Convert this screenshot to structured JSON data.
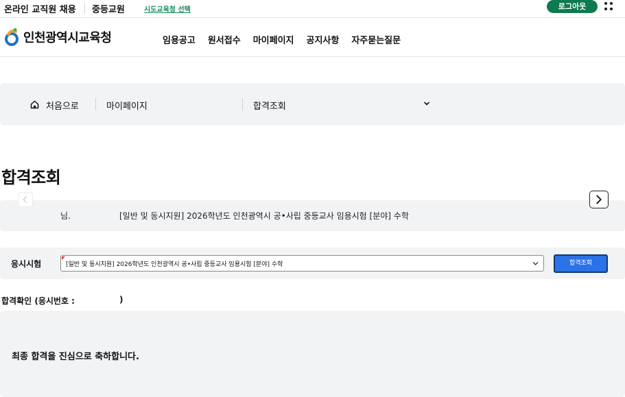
{
  "topbar": {
    "site_name": "온라인 교직원 채용",
    "site_sub": "중등교원",
    "region_link": "시도교육청 선택",
    "logout_label": "로그아웃"
  },
  "navbar": {
    "logo_text": "인천광역시교육청",
    "menu": [
      "임용공고",
      "원서접수",
      "마이페이지",
      "공지사항",
      "자주묻는질문"
    ]
  },
  "breadcrumb": {
    "home": "처음으로",
    "level1": "마이페이지",
    "current": "합격조회"
  },
  "page_title": "합격조회",
  "notice": {
    "name_suffix": "님.",
    "exam_name": "[일반 및 동시지원] 2026학년도 인천광역시 공•사립 중등교사 임용시험 [분야] 수학"
  },
  "exam": {
    "label": "응시시험",
    "selected": "[일반 및 동시지원] 2026학년도 인천광역시 공•사립 중등교사 임용시험 [분야] 수학",
    "search_label": "합격조회"
  },
  "confirm": {
    "title": "합격확인 (응시번호 :",
    "close": ")"
  },
  "result": {
    "message": "최종 합격을 진심으로 축하합니다."
  },
  "colors": {
    "brand_green": "#0e7a4f",
    "link_green": "#1a8a5a",
    "button_blue": "#2b72e6",
    "panel_gray": "#f2f3f5"
  },
  "icons": [
    "logo-icon",
    "more-dots-icon",
    "home-icon",
    "chevron-down-icon",
    "chevron-left-icon",
    "chevron-right-icon"
  ]
}
